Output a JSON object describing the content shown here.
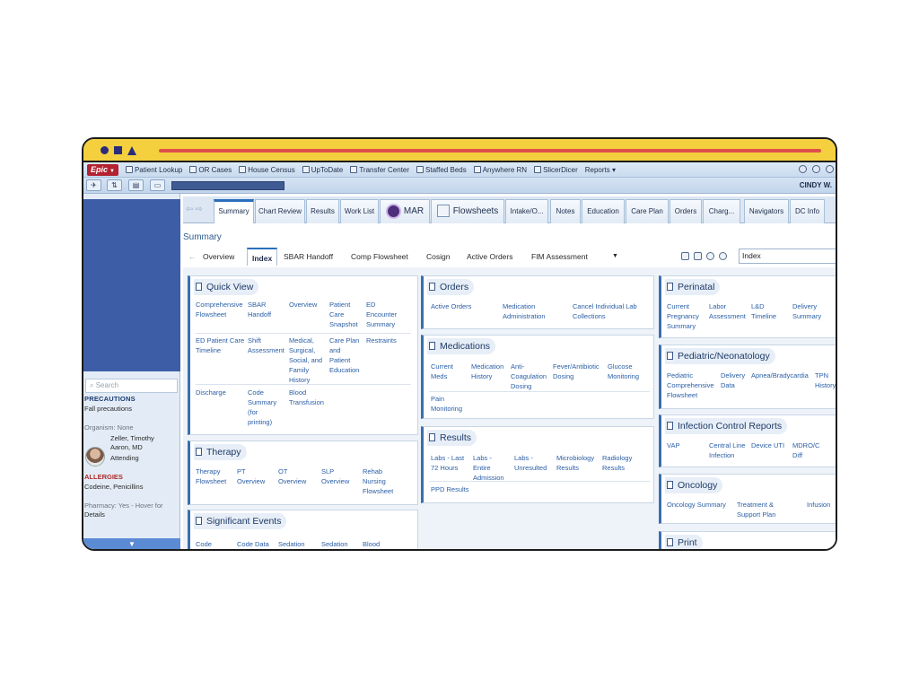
{
  "app": {
    "logo": "Epic",
    "menu": [
      {
        "label": "Patient Lookup",
        "icon": "person-icon"
      },
      {
        "label": "OR Cases",
        "icon": "calendar-icon"
      },
      {
        "label": "House Census",
        "icon": "house-icon"
      },
      {
        "label": "UpToDate",
        "icon": "book-icon"
      },
      {
        "label": "Transfer Center",
        "icon": "transfer-icon"
      },
      {
        "label": "Staffed Beds",
        "icon": "bed-icon"
      },
      {
        "label": "Anywhere RN",
        "icon": "nurse-icon"
      },
      {
        "label": "SlicerDicer",
        "icon": "chart-icon"
      },
      {
        "label": "Reports ▾",
        "icon": ""
      }
    ],
    "user": "CINDY W."
  },
  "sidebar": {
    "search_placeholder": "Search",
    "precautions_head": "PRECAUTIONS",
    "precautions": "Fall precautions",
    "organism": "Organism: None",
    "provider_name_1": "Zeller, Timothy",
    "provider_name_2": "Aaron, MD",
    "provider_role": "Attending",
    "allergies_head": "ALLERGIES",
    "allergies": "Codeine, Penicillins",
    "pharmacy_1": "Pharmacy: Yes - Hover for",
    "pharmacy_2": "Details",
    "bottom_arrow": "▼"
  },
  "tabs": {
    "arrows": "⇦⇨",
    "items": [
      "Summary",
      "Chart Review",
      "Results",
      "Work List",
      "MAR",
      "Flowsheets",
      "Intake/O...",
      "Notes",
      "Education",
      "Care Plan",
      "Orders",
      "Charg...",
      "Navigators",
      "DC Info"
    ]
  },
  "section_title": "Summary",
  "subtabs": {
    "back": "←",
    "items": [
      "Overview",
      "Index",
      "SBAR Handoff",
      "Comp Flowsheet",
      "Cosign",
      "Active Orders",
      "FIM Assessment"
    ],
    "caret": "▼",
    "index_value": "Index"
  },
  "cards": {
    "quick_view": {
      "title": "Quick View",
      "row1": [
        "Comprehensive\nFlowsheet",
        "SBAR\nHandoff",
        "Overview",
        "Patient\nCare\nSnapshot",
        "ED\nEncounter\nSummary"
      ],
      "row2": [
        "ED Patient Care\nTimeline",
        "Shift\nAssessment",
        "Medical,\nSurgical,\nSocial, and\nFamily\nHistory",
        "Care Plan\nand\nPatient\nEducation",
        "Restraints"
      ],
      "row3": [
        "Discharge",
        "Code\nSummary\n(for\nprinting)",
        "Blood\nTransfusion"
      ]
    },
    "therapy": {
      "title": "Therapy",
      "items": [
        "Therapy\nFlowsheet",
        "PT\nOverview",
        "OT\nOverview",
        "SLP\nOverview",
        "Rehab\nNursing\nFlowsheet"
      ]
    },
    "significant_events": {
      "title": "Significant Events",
      "items": [
        "Code",
        "Code Data",
        "Sedation",
        "Sedation",
        "Blood"
      ]
    },
    "orders": {
      "title": "Orders",
      "items": [
        "Active Orders",
        "Medication\nAdministration",
        "Cancel Individual Lab\nCollections"
      ]
    },
    "medications": {
      "title": "Medications",
      "row1": [
        "Current\nMeds",
        "Medication\nHistory",
        "Anti-\nCoagulation\nDosing",
        "Fever/Antibiotic\nDosing",
        "Glucose\nMonitoring"
      ],
      "row2": [
        "Pain\nMonitoring"
      ]
    },
    "results": {
      "title": "Results",
      "row1": [
        "Labs - Last\n72 Hours",
        "Labs -\nEntire\nAdmission",
        "Labs -\nUnresulted",
        "Microbiology\nResults",
        "Radiology\nResults"
      ],
      "row2": [
        "PPD Results"
      ]
    },
    "perinatal": {
      "title": "Perinatal",
      "items": [
        "Current\nPregnancy\nSummary",
        "Labor\nAssessment",
        "L&D\nTimeline",
        "Delivery\nSummary"
      ]
    },
    "pediatric": {
      "title": "Pediatric/Neonatology",
      "items": [
        "Pediatric\nComprehensive\nFlowsheet",
        "Delivery\nData",
        "Apnea/Bradycardia",
        "TPN\nHistory"
      ]
    },
    "infection": {
      "title": "Infection Control Reports",
      "items": [
        "VAP",
        "Central Line\nInfection",
        "Device UTI",
        "MDRO/C\nDiff"
      ]
    },
    "oncology": {
      "title": "Oncology",
      "items": [
        "Oncology Summary",
        "Treatment &\nSupport Plan",
        "Infusion"
      ]
    },
    "print": {
      "title": "Print"
    }
  }
}
